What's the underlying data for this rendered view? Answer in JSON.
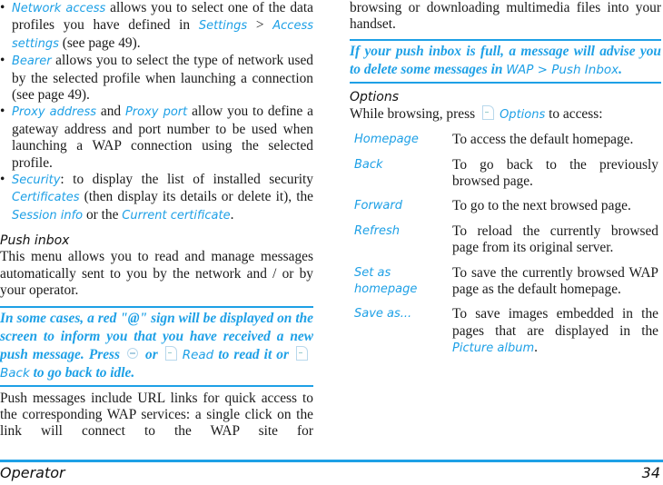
{
  "colors": {
    "accent": "#1ea0e6",
    "text": "#1a1a1a"
  },
  "left": {
    "bullets": [
      {
        "parts": [
          "Network access",
          " allows you to select one of the data profiles you have defined in ",
          "Settings",
          " > ",
          "Access settings",
          " (see page 49)."
        ]
      },
      {
        "parts": [
          "Bearer",
          " allows you to select the type of network used by the selected profile when launching a connection (see page 49)."
        ]
      },
      {
        "parts": [
          "Proxy address",
          " and ",
          "Proxy port",
          " allow you to define a gateway address and port number to be used when launching a WAP connection using the selected profile."
        ]
      },
      {
        "parts": [
          "Security",
          ": to display the list of installed security ",
          "Certificates",
          " (then display its details or delete it), the ",
          "Session info",
          " or the ",
          "Current certificate",
          "."
        ]
      }
    ],
    "push_inbox": {
      "title": "Push inbox",
      "intro": "This menu allows you to read and manage messages automatically sent to you by the network and / or by your operator.",
      "note": {
        "t1": "In some cases, a red \"@\" sign will be displayed on the screen to inform you that you have received a new push message. Press",
        "ok_icon": "ok-key-icon",
        "t2": "or",
        "softkey_icon": "left-softkey-icon",
        "read": "Read",
        "t3": "to read it or",
        "back": "Back",
        "t4": "to go back to idle."
      },
      "body": "Push messages include URL links for quick access to the corresponding WAP services: a single click on the link will connect to the WAP site for"
    }
  },
  "right": {
    "continuation": "browsing or downloading multimedia files into your handset.",
    "note": {
      "t1": "If your push inbox is full, a message will advise you to delete some messages in",
      "path": "WAP > Push Inbox",
      "t2": "."
    },
    "options": {
      "title": "Options",
      "intro_before": "While browsing, press",
      "intro_key": "Options",
      "intro_after": "to access:",
      "items": [
        {
          "key": "Homepage",
          "desc": "To access the default homepage."
        },
        {
          "key": "Back",
          "desc": "To go back to the previously browsed page."
        },
        {
          "key": "Forward",
          "desc": "To go to the next browsed page."
        },
        {
          "key": "Refresh",
          "desc": "To reload the currently browsed page from its original server."
        },
        {
          "key": "Set as homepage",
          "desc": "To save the currently browsed WAP page as the default homepage."
        },
        {
          "key": "Save as...",
          "desc_before": "To save images embedded in the pages that are displayed in the",
          "desc_link": "Picture album",
          "desc_after": "."
        }
      ]
    }
  },
  "footer": {
    "section": "Operator",
    "page": "34"
  }
}
